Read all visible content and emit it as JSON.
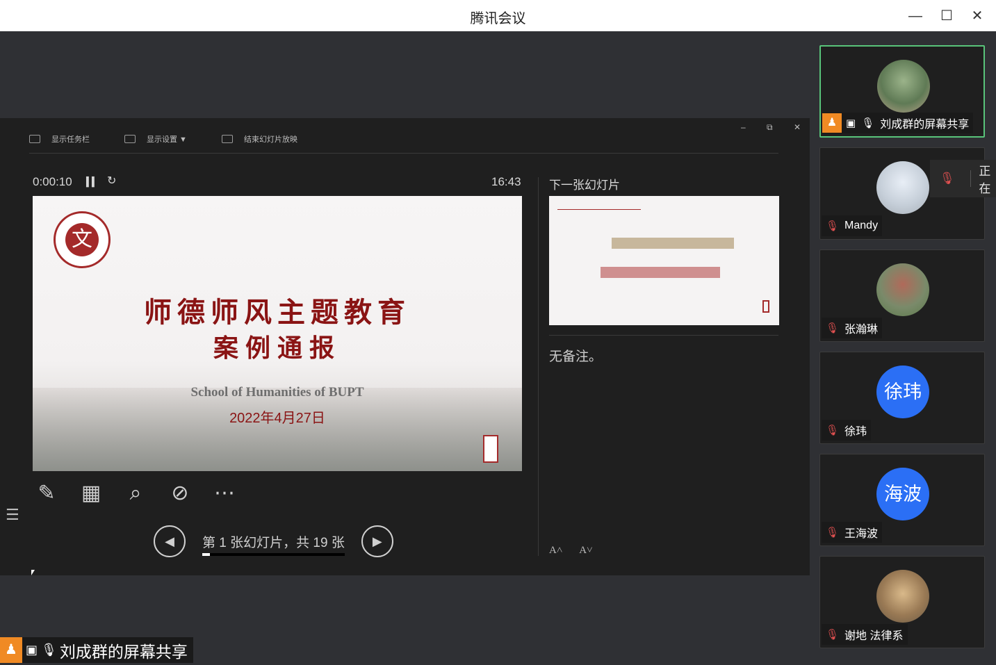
{
  "window": {
    "title": "腾讯会议",
    "minimize": "—",
    "maximize": "☐",
    "close": "✕"
  },
  "ppt": {
    "toolbar": [
      {
        "label": "显示任务栏"
      },
      {
        "label": "显示设置 ▼"
      },
      {
        "label": "结束幻灯片放映"
      }
    ],
    "elapsed": "0:00:10",
    "clock": "16:43",
    "current_slide": {
      "headline_line1": "师德师风主题教育",
      "headline_line2": "案例通报",
      "school": "School of Humanities of BUPT",
      "date": "2022年4月27日"
    },
    "next_label": "下一张幻灯片",
    "notes": "无备注。",
    "slide_counter": "第 1 张幻灯片，共 19 张",
    "slide_progress": 0.053,
    "tools": [
      "pen-icon",
      "layout-icon",
      "zoom-icon",
      "screen-off-icon",
      "more-icon"
    ]
  },
  "share_label": {
    "text": "刘成群的屏幕共享"
  },
  "participants": [
    {
      "name": "刘成群的屏幕共享",
      "muted": false,
      "active": true,
      "avatar": "photo"
    },
    {
      "name": "Mandy",
      "muted": true,
      "avatar": "photo"
    },
    {
      "name": "张瀚琳",
      "muted": true,
      "avatar": "photo"
    },
    {
      "name": "徐玮",
      "muted": true,
      "avatar": "徐玮"
    },
    {
      "name": "王海波",
      "muted": true,
      "avatar": "海波"
    },
    {
      "name": "谢地 法律系",
      "muted": true,
      "avatar": "photo"
    }
  ],
  "speaking_popup": "正在",
  "colors": {
    "accent_green": "#59c47a",
    "avatar_blue": "#2b6ff5",
    "host_orange": "#f08a24",
    "brand_red": "#8a1414"
  }
}
